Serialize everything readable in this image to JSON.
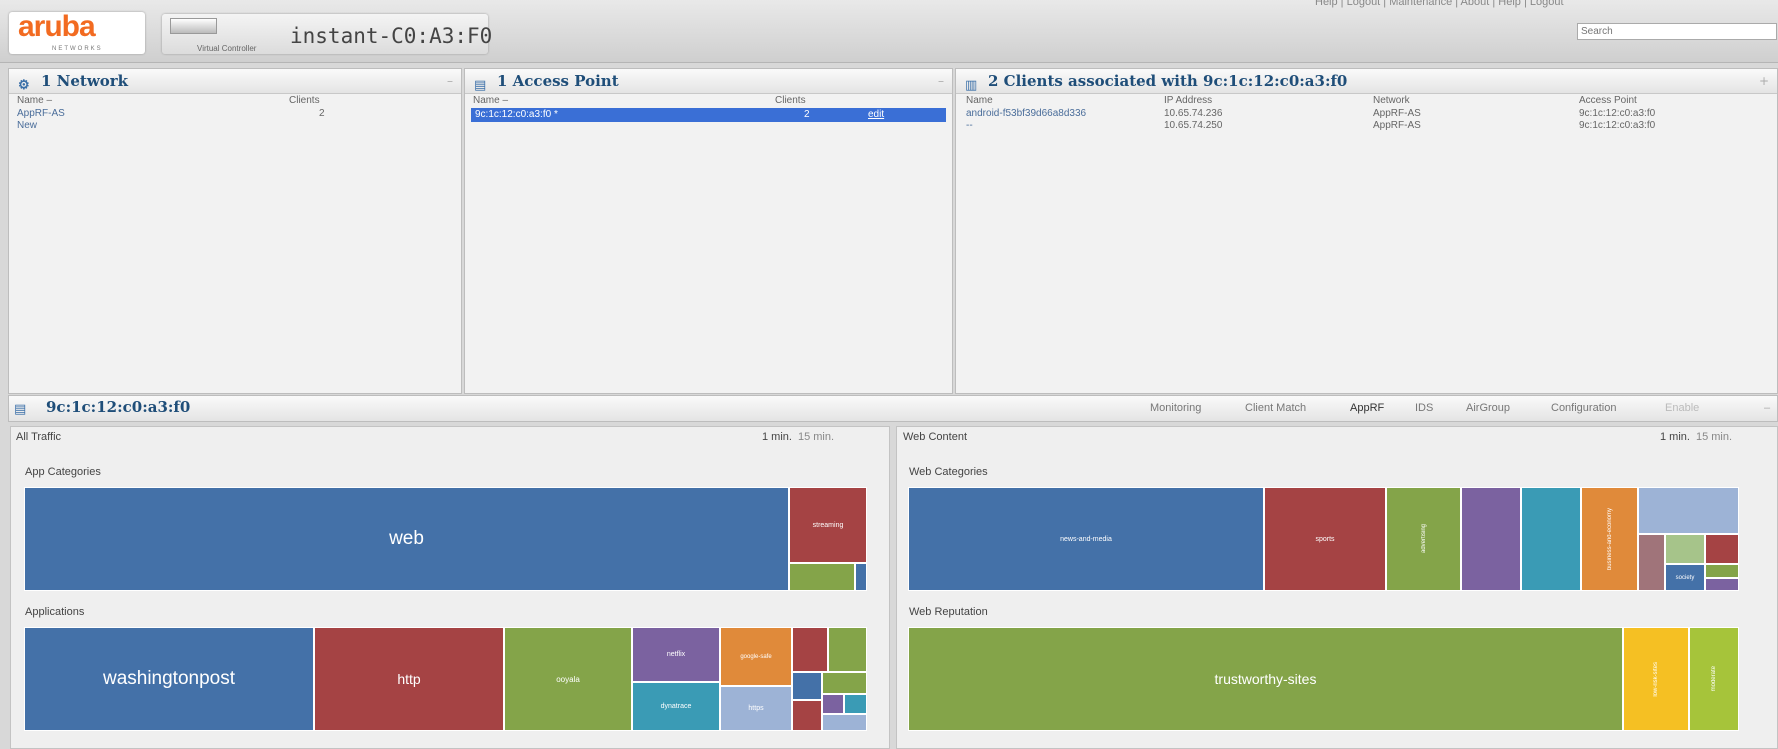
{
  "header": {
    "logo": "aruba",
    "logo_sub": "NETWORKS",
    "vc_label": "Virtual Controller",
    "vc_name": "instant-C0:A3:F0",
    "top_links": "Help  |  Logout  |  Maintenance  |  About  |  Help  |  Logout",
    "search_placeholder": "Search"
  },
  "networks": {
    "title": "1 Network",
    "col_name": "Name –",
    "col_clients": "Clients",
    "rows": [
      {
        "name": "AppRF-AS",
        "clients": "2"
      }
    ],
    "new_label": "New"
  },
  "access_points": {
    "title": "1 Access Point",
    "col_name": "Name –",
    "col_clients": "Clients",
    "rows": [
      {
        "name": "9c:1c:12:c0:a3:f0 *",
        "clients": "2",
        "action": "edit"
      }
    ]
  },
  "clients": {
    "title": "2 Clients associated with 9c:1c:12:c0:a3:f0",
    "cols": [
      "Name",
      "IP Address",
      "Network",
      "Access Point"
    ],
    "rows": [
      {
        "name": "android-f53bf39d66a8d336",
        "ip": "10.65.74.236",
        "network": "AppRF-AS",
        "ap": "9c:1c:12:c0:a3:f0"
      },
      {
        "name": "--",
        "ip": "10.65.74.250",
        "network": "AppRF-AS",
        "ap": "9c:1c:12:c0:a3:f0"
      }
    ]
  },
  "bottom": {
    "title": "9c:1c:12:c0:a3:f0",
    "tabs": [
      "Monitoring",
      "Client Match",
      "AppRF",
      "IDS",
      "AirGroup",
      "Configuration",
      "Enable"
    ],
    "active_tab": "AppRF"
  },
  "all_traffic": {
    "title": "All Traffic",
    "t1": "1 min.",
    "t2": "15 min.",
    "app_categories_label": "App Categories",
    "applications_label": "Applications",
    "app_categories": [
      {
        "label": "web",
        "color": "#4471a8"
      },
      {
        "label": "streaming",
        "color": "#a54344"
      },
      {
        "label": "",
        "color": "#84a449"
      },
      {
        "label": "",
        "color": "#4471a8"
      }
    ],
    "applications": [
      {
        "label": "washingtonpost",
        "color": "#4471a8"
      },
      {
        "label": "http",
        "color": "#a54344"
      },
      {
        "label": "ooyala",
        "color": "#84a449"
      },
      {
        "label": "netflix",
        "color": "#7b62a0"
      },
      {
        "label": "google-safe",
        "color": "#e08a3a"
      },
      {
        "label": "dynatrace",
        "color": "#3a9bb5"
      },
      {
        "label": "https",
        "color": "#9db3d6"
      }
    ]
  },
  "web_content": {
    "title": "Web Content",
    "t1": "1 min.",
    "t2": "15 min.",
    "web_categories_label": "Web Categories",
    "web_reputation_label": "Web Reputation",
    "web_categories": [
      {
        "label": "news-and-media",
        "color": "#4471a8"
      },
      {
        "label": "sports",
        "color": "#a54344"
      },
      {
        "label": "advertising",
        "color": "#84a449"
      },
      {
        "label": "",
        "color": "#7b62a0"
      },
      {
        "label": "",
        "color": "#3a9bb5"
      },
      {
        "label": "business-and-economy",
        "color": "#e08a3a"
      },
      {
        "label": "",
        "color": "#9db3d6"
      },
      {
        "label": "society",
        "color": "#4471a8"
      }
    ],
    "web_reputation": [
      {
        "label": "trustworthy-sites",
        "color": "#84a449"
      },
      {
        "label": "low-risk-sites",
        "color": "#f5c023"
      },
      {
        "label": "moderate",
        "color": "#a6c43a"
      }
    ]
  }
}
